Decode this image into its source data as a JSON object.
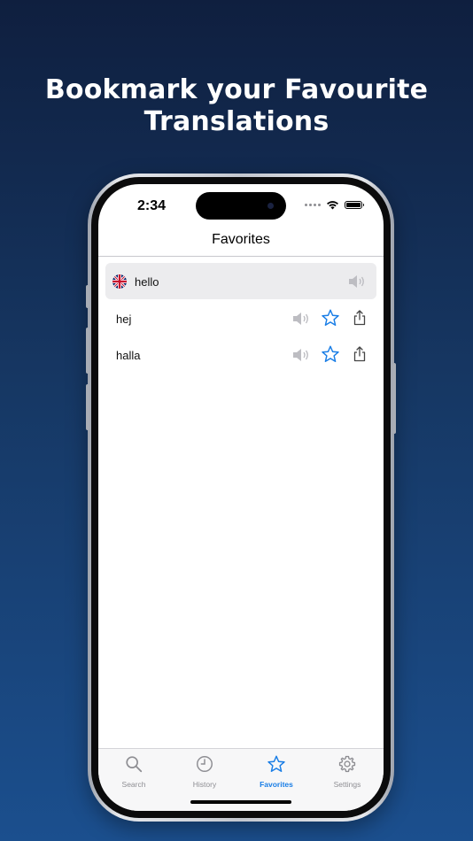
{
  "headline": {
    "line1": "Bookmark your Favourite",
    "line2": "Translations"
  },
  "status_bar": {
    "time": "2:34"
  },
  "nav": {
    "title": "Favorites"
  },
  "source": {
    "flag": "uk-flag-icon",
    "word": "hello"
  },
  "translations": [
    {
      "word": "hej"
    },
    {
      "word": "halla"
    }
  ],
  "tabs": [
    {
      "label": "Search",
      "icon": "search-icon",
      "active": false
    },
    {
      "label": "History",
      "icon": "clock-icon",
      "active": false
    },
    {
      "label": "Favorites",
      "icon": "star-icon",
      "active": true
    },
    {
      "label": "Settings",
      "icon": "gear-icon",
      "active": false
    }
  ],
  "colors": {
    "accent": "#1a7ee6",
    "icon_gray": "#8e8e93",
    "background_top": "#0f1f3f",
    "background_bottom": "#1b4f8e"
  }
}
